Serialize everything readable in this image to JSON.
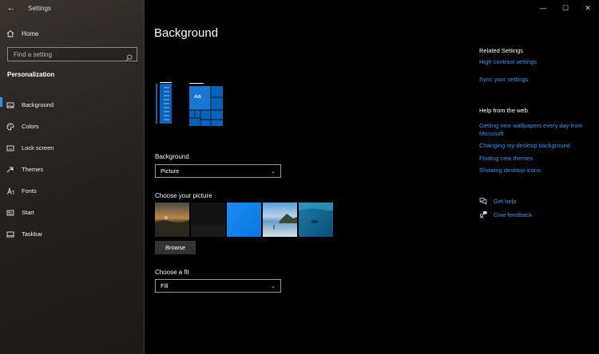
{
  "window": {
    "app_title": "Settings",
    "back_glyph": "←",
    "minimize_glyph": "—",
    "maximize_glyph": "☐",
    "close_glyph": "✕"
  },
  "sidebar": {
    "home_label": "Home",
    "search": {
      "placeholder": "Find a setting",
      "value": ""
    },
    "section_heading": "Personalization",
    "items": [
      {
        "label": "Background",
        "icon": "picture-icon",
        "active": true
      },
      {
        "label": "Colors",
        "icon": "palette-icon",
        "active": false
      },
      {
        "label": "Lock screen",
        "icon": "lock-screen-icon",
        "active": false
      },
      {
        "label": "Themes",
        "icon": "themes-brush-icon",
        "active": false
      },
      {
        "label": "Fonts",
        "icon": "font-icon",
        "active": false
      },
      {
        "label": "Start",
        "icon": "start-icon",
        "active": false
      },
      {
        "label": "Taskbar",
        "icon": "taskbar-icon",
        "active": false
      }
    ]
  },
  "main": {
    "title": "Background",
    "preview_tile_text": "Aa",
    "background_label": "Background",
    "background_value": "Picture",
    "choose_picture_label": "Choose your picture",
    "browse_label": "Browse",
    "choose_fit_label": "Choose a fit",
    "fit_value": "Fill",
    "accent": "#0078d7"
  },
  "related": {
    "heading": "Related Settings",
    "links": [
      "High contrast settings",
      "Sync your settings"
    ]
  },
  "help": {
    "heading": "Help from the web",
    "links": [
      "Getting new wallpapers every day from Microsoft",
      "Changing my desktop background",
      "Finding new themes",
      "Showing desktop icons"
    ],
    "get_help": "Get help",
    "give_feedback": "Give feedback",
    "link_color": "#3b8fe6"
  }
}
